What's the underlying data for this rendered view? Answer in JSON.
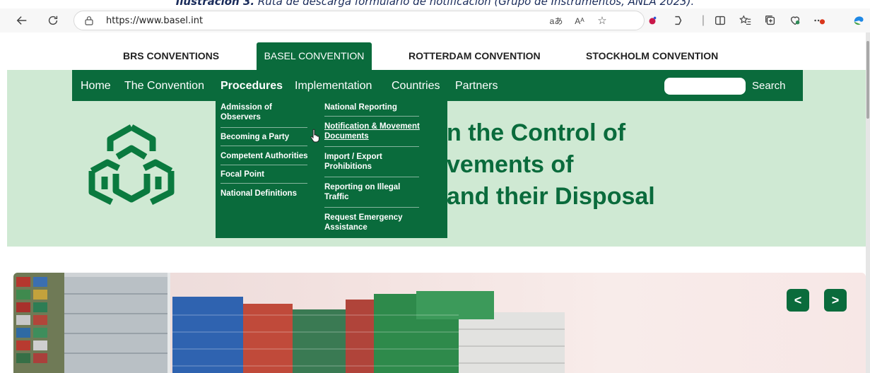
{
  "caption": {
    "bold": "Ilustración 3.",
    "text": " Ruta de descarga formulario de notificación (Grupo de Instrumentos, ANLA 2023)."
  },
  "browser": {
    "url": "https://www.basel.int",
    "icons": [
      "back-icon",
      "reload-icon",
      "lock-icon",
      "read-aloud-icon",
      "text-size-icon",
      "favorite-star-icon",
      "extension-icon",
      "copilot-icon",
      "split-screen-icon",
      "favorites-icon",
      "collections-icon",
      "performance-icon",
      "more-icon",
      "profile-icon"
    ]
  },
  "conventions": {
    "tabs": [
      "BRS CONVENTIONS",
      "BASEL CONVENTION",
      "ROTTERDAM CONVENTION",
      "STOCKHOLM CONVENTION"
    ],
    "active": "BASEL CONVENTION"
  },
  "nav": {
    "items": [
      "Home",
      "The Convention",
      "Procedures",
      "Implementation",
      "Countries",
      "Partners"
    ],
    "active": "Procedures",
    "search_label": "Search",
    "search_placeholder": ""
  },
  "dropdown": {
    "left": [
      "Admission of Observers",
      "Becoming a Party",
      "Competent Authorities",
      "Focal Point",
      "National Definitions"
    ],
    "right": [
      "National Reporting",
      "Notification & Movement Documents",
      "Import / Export Prohibitions",
      "Reporting on Illegal Traffic",
      "Request Emergency Assistance"
    ]
  },
  "hero": {
    "title_lines": [
      "n the Control of",
      "vements of",
      "and their Disposal"
    ]
  },
  "slider": {
    "prev_label": "<",
    "next_label": ">"
  },
  "colors": {
    "brand_green": "#0a6b3c",
    "hero_bg": "#cfe9d3"
  }
}
